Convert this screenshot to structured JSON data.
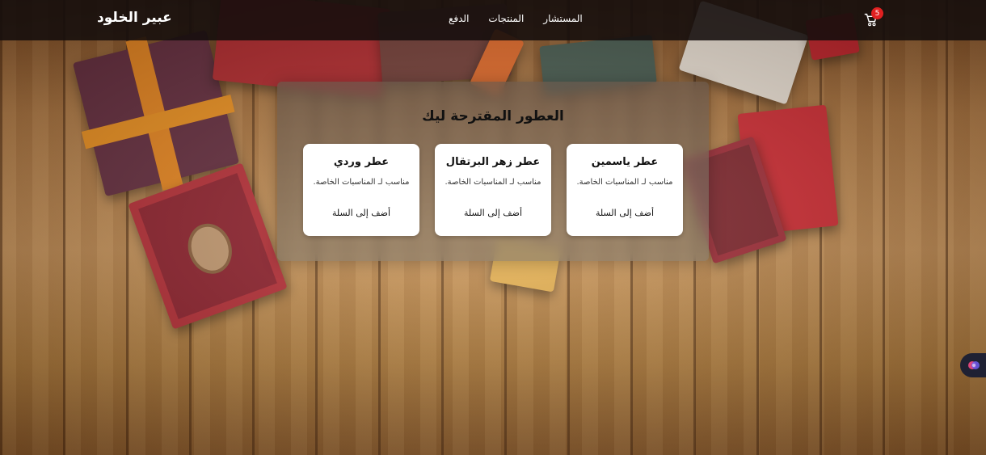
{
  "navbar": {
    "brand": "عبير الخلود",
    "links": [
      "الدفع",
      "المنتجات",
      "المستشار"
    ],
    "cart_count": "5",
    "cart_icon": "cart-icon"
  },
  "recommendations": {
    "title": "العطور المقترحة ليك",
    "cards": [
      {
        "title": "عطر ياسمين",
        "description": "مناسب لـ المناسبات الخاصة.",
        "button": "أضف إلى السلة"
      },
      {
        "title": "عطر زهر البرتقال",
        "description": "مناسب لـ المناسبات الخاصة.",
        "button": "أضف إلى السلة"
      },
      {
        "title": "عطر وردي",
        "description": "مناسب لـ المناسبات الخاصة.",
        "button": "أضف إلى السلة"
      }
    ]
  },
  "widget": {
    "icon": "assistant-orb-icon"
  },
  "colors": {
    "navbar_bg": "#140e0c",
    "badge": "#e02020",
    "card_bg": "#ffffff"
  }
}
